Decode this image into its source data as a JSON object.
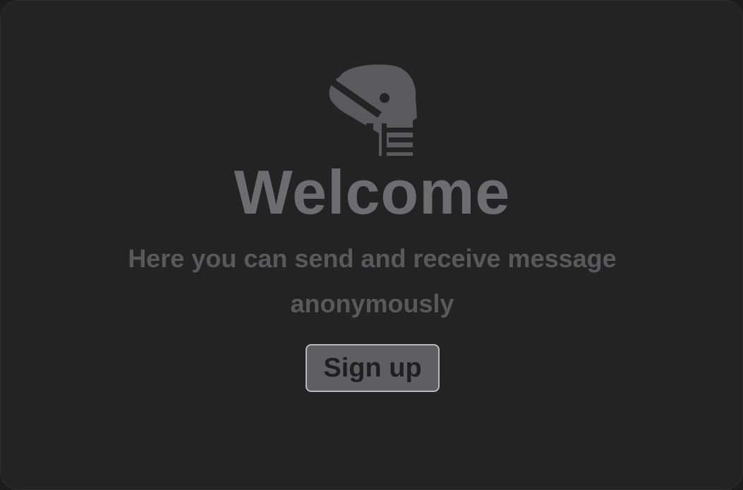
{
  "app": {
    "logo_icon": "masked-head-letter-e-logo-icon"
  },
  "welcome": {
    "title": "Welcome",
    "subtitle": "Here you can send and receive message anonymously"
  },
  "actions": {
    "signup_label": "Sign up"
  },
  "colors": {
    "background": "#232323",
    "title": "#6d6d6f",
    "subtitle": "#59595b",
    "button_bg": "#5f5f61",
    "button_border": "#b9b9bb",
    "button_text": "#1f1f1f"
  }
}
